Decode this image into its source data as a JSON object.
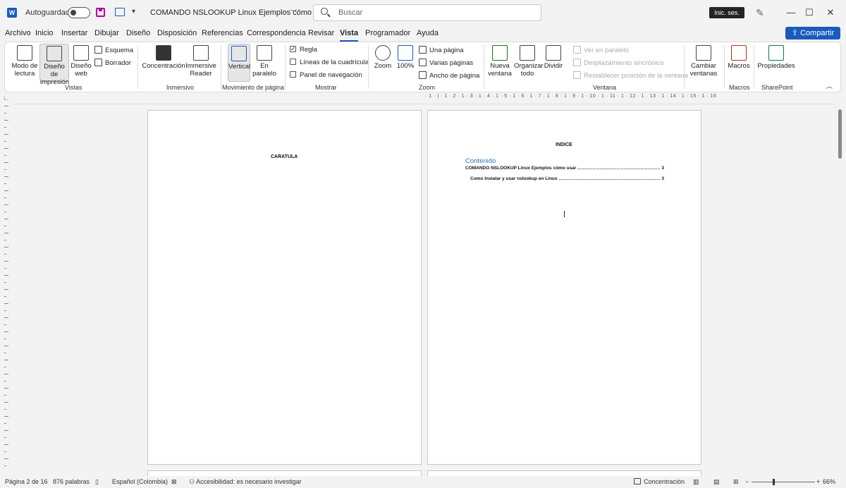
{
  "titlebar": {
    "app_letter": "W",
    "autosave_label": "Autoguardado",
    "doc_title": "COMANDO NSLOOKUP Linux  Ejemplos cómo usar",
    "search_placeholder": "Buscar",
    "signin_label": "Inic. ses.",
    "minimize": "—",
    "maximize": "☐",
    "close": "✕"
  },
  "tabs": [
    {
      "label": "Archivo"
    },
    {
      "label": "Inicio"
    },
    {
      "label": "Insertar"
    },
    {
      "label": "Dibujar"
    },
    {
      "label": "Diseño"
    },
    {
      "label": "Disposición"
    },
    {
      "label": "Referencias"
    },
    {
      "label": "Correspondencia"
    },
    {
      "label": "Revisar"
    },
    {
      "label": "Vista"
    },
    {
      "label": "Programador"
    },
    {
      "label": "Ayuda"
    }
  ],
  "share_label": "Compartir",
  "ribbon": {
    "vistas": {
      "group": "Vistas",
      "modo_lectura": "Modo de lectura",
      "diseno_impresion": "Diseño de impresión",
      "diseno_web": "Diseño web",
      "esquema": "Esquema",
      "borrador": "Borrador"
    },
    "inmersivo": {
      "group": "Inmersivo",
      "concentracion": "Concentración",
      "immersive_reader": "Immersive Reader"
    },
    "movimiento": {
      "group": "Movimiento de página",
      "vertical": "Vertical",
      "en_paralelo": "En paralelo"
    },
    "mostrar": {
      "group": "Mostrar",
      "regla": "Regla",
      "lineas": "Líneas de la cuadrícula",
      "panel": "Panel de navegación"
    },
    "zoom": {
      "group": "Zoom",
      "zoom": "Zoom",
      "cien": "100%",
      "una_pagina": "Una página",
      "varias_paginas": "Varias páginas",
      "ancho_pagina": "Ancho de página"
    },
    "ventana": {
      "group": "Ventana",
      "nueva_ventana": "Nueva ventana",
      "organizar_todo": "Organizar todo",
      "dividir": "Dividir",
      "ver_paralelo": "Ver en paralelo",
      "desplazamiento": "Desplazamiento sincrónico",
      "restablecer": "Restablecer posición de la ventana",
      "cambiar_ventanas": "Cambiar ventanas"
    },
    "macros": {
      "group": "Macros",
      "macros": "Macros"
    },
    "sharepoint": {
      "group": "SharePoint",
      "propiedades": "Propiedades"
    }
  },
  "ruler_text": "· 1 · | · 1 · 2 · 1 · 3 · 1 · 4 · 1 · 5 · 1 · 6 · 1 · 7 · 1 · 8 · 1 · 9 · 1 · 10 · 1 · 11 · 1 · 12 · 1 · 13 · 1 · 14 · 1 · 15 · 1 · 16",
  "document": {
    "page1_title": "CARATULA",
    "page2_title": "INDICE",
    "toc_heading": "Contenido",
    "toc": [
      {
        "text": "COMANDO NSLOOKUP Linux  Ejemplos cómo usar",
        "page": "3"
      },
      {
        "text": "Como instalar y usar nslookup en Linux",
        "page": "3"
      }
    ]
  },
  "statusbar": {
    "page": "Página 2 de 16",
    "words": "876 palabras",
    "language": "Español (Colombia)",
    "accessibility": "Accesibilidad: es necesario investigar",
    "focus": "Concentración",
    "zoom": "66%",
    "zoom_fraction": 0.33
  }
}
